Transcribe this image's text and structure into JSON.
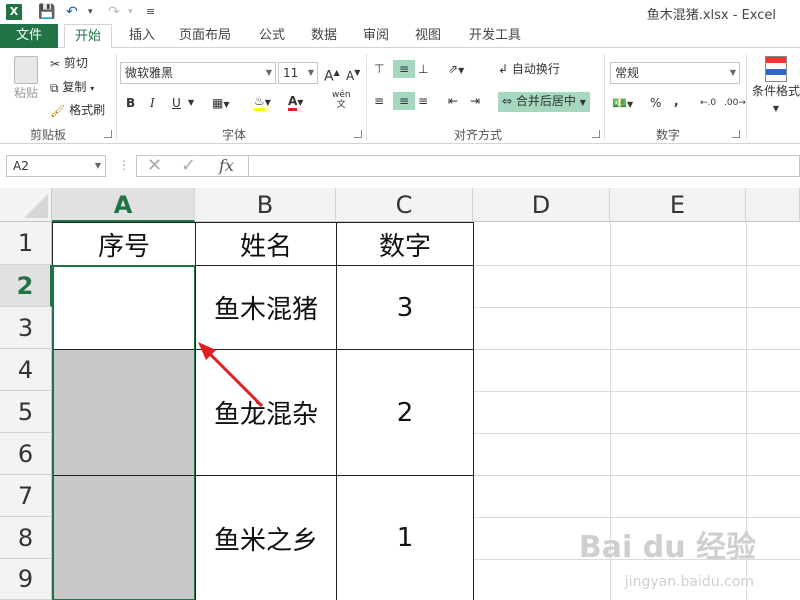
{
  "window": {
    "title": "鱼木混猪.xlsx - Excel"
  },
  "ribbon_tabs": {
    "file": "文件",
    "home": "开始",
    "insert": "插入",
    "layout": "页面布局",
    "formulas": "公式",
    "data": "数据",
    "review": "审阅",
    "view": "视图",
    "developer": "开发工具"
  },
  "clipboard": {
    "paste": "粘贴",
    "cut": "剪切",
    "copy": "复制",
    "format_painter": "格式刷",
    "label": "剪贴板"
  },
  "font": {
    "name": "微软雅黑",
    "size": "11",
    "bold": "B",
    "italic": "I",
    "underline": "U",
    "label": "字体",
    "phonetic": "wén"
  },
  "alignment": {
    "wrap_text": "自动换行",
    "merge_center": "合并后居中",
    "label": "对齐方式"
  },
  "number": {
    "format": "常规",
    "percent": "%",
    "comma": ",",
    "label": "数字"
  },
  "styles": {
    "conditional": "条件格式"
  },
  "formula_bar": {
    "name_box": "A2",
    "fx": "fx",
    "value": ""
  },
  "sheet": {
    "columns": [
      "A",
      "B",
      "C",
      "D",
      "E"
    ],
    "rows": [
      "1",
      "2",
      "3",
      "4",
      "5",
      "6",
      "7",
      "8",
      "9"
    ],
    "headers": [
      "序号",
      "姓名",
      "数字"
    ],
    "records": [
      {
        "name": "鱼木混猪",
        "number": "3"
      },
      {
        "name": "鱼龙混杂",
        "number": "2"
      },
      {
        "name": "鱼米之乡",
        "number": "1"
      }
    ],
    "active_column": "A",
    "active_cell": "A2"
  },
  "watermark": {
    "main": "Bai du 经验",
    "url": "jingyan.baidu.com"
  },
  "colors": {
    "excel_green": "#217346",
    "arrow_red": "#e02020",
    "selected_cell_fill": "#c8c8c8"
  }
}
